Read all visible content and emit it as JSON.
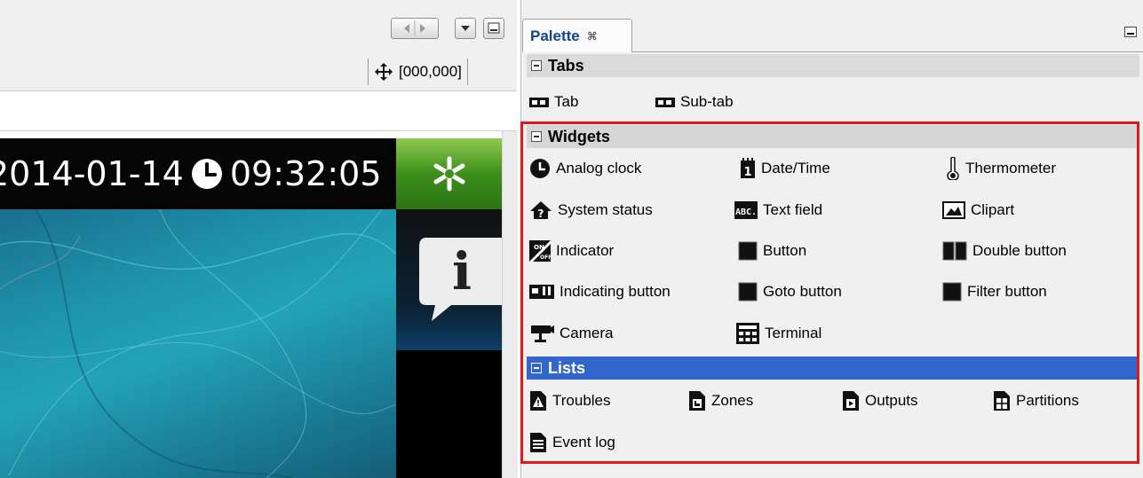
{
  "editor": {
    "coordinates": "[000,000]",
    "date": "2014-01-14",
    "time": "09:32:05",
    "info_glyph": "i"
  },
  "palette": {
    "title": "Palette",
    "close_glyph": "⌘",
    "groups": {
      "tabs": {
        "label": "Tabs",
        "items": [
          "Tab",
          "Sub-tab"
        ]
      },
      "widgets": {
        "label": "Widgets",
        "items": [
          "Analog clock",
          "Date/Time",
          "Thermometer",
          "System status",
          "Text field",
          "Clipart",
          "Indicator",
          "Button",
          "Double button",
          "Indicating button",
          "Goto button",
          "Filter button",
          "Camera",
          "Terminal"
        ]
      },
      "lists": {
        "label": "Lists",
        "items": [
          "Troubles",
          "Zones",
          "Outputs",
          "Partitions",
          "Event log"
        ]
      }
    }
  },
  "colors": {
    "highlight_frame": "#e01818",
    "selected_group": "#3366cc",
    "tab_title": "#15428b"
  }
}
